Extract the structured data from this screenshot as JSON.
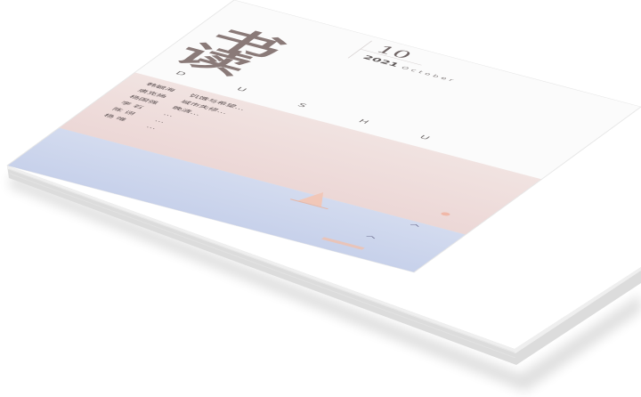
{
  "magazine": {
    "title": "读书",
    "title_chars": [
      "读",
      "书"
    ],
    "issue_number": "10",
    "year": "2021",
    "month": "October",
    "latin_letters": [
      "D",
      "U",
      "S",
      "H",
      "U"
    ]
  },
  "toc": [
    {
      "author": "韩毓海",
      "title": "饥饿与希望…"
    },
    {
      "author": "唐克扬",
      "title": "城市失修…"
    },
    {
      "author": "杨国强",
      "title": "晚清…"
    },
    {
      "author": "李 石",
      "title": "…"
    },
    {
      "author": "陈 诩",
      "title": "…"
    },
    {
      "author": "杨 唯",
      "title": "…"
    }
  ],
  "colors": {
    "page_white": "#fbfbfb",
    "band_pink": "#efe0df",
    "sea_blue": "#cfd8ee",
    "spine": "#d9d9d9",
    "title_color": "#8a7a78"
  }
}
